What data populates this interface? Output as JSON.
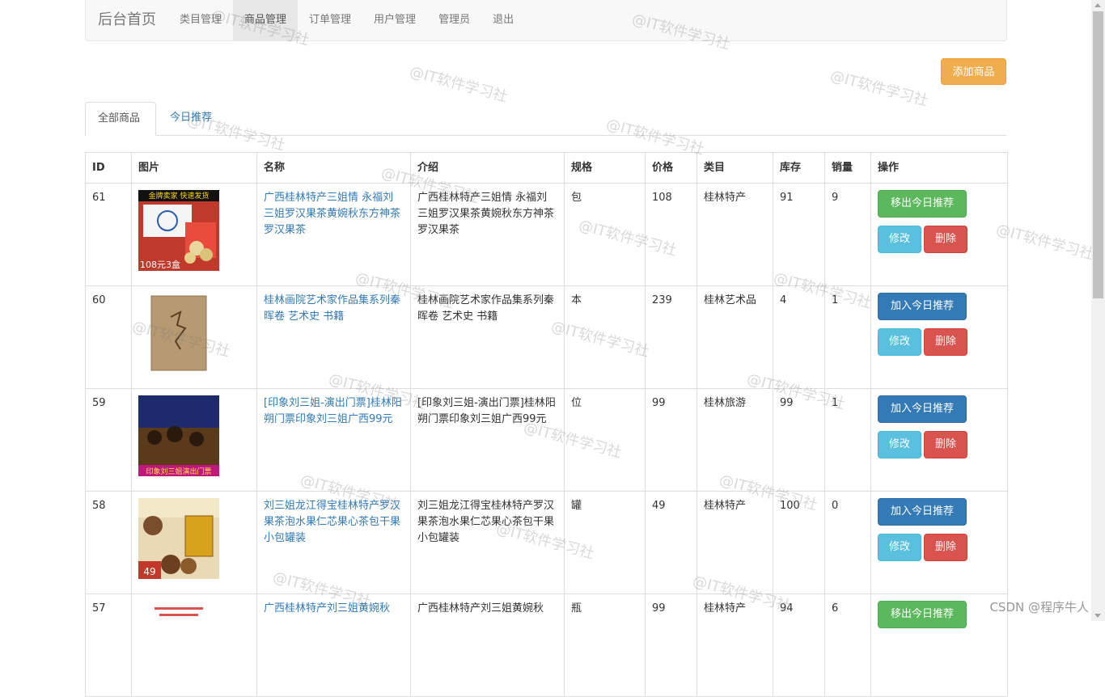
{
  "navbar": {
    "brand": "后台首页",
    "items": [
      "类目管理",
      "商品管理",
      "订单管理",
      "用户管理",
      "管理员",
      "退出"
    ],
    "active_index": 1
  },
  "add_button": "添加商品",
  "tabs": [
    "全部商品",
    "今日推荐"
  ],
  "table": {
    "headers": [
      "ID",
      "图片",
      "名称",
      "介绍",
      "规格",
      "价格",
      "类目",
      "库存",
      "销量",
      "操作"
    ],
    "rows": [
      {
        "id": "61",
        "name": "广西桂林特产三姐情 永福刘三姐罗汉果茶黄婉秋东方神茶罗汉果茶",
        "intro": "广西桂林特产三姐情 永福刘三姐罗汉果茶黄婉秋东方神茶罗汉果茶",
        "spec": "包",
        "price": "108",
        "category": "桂林特产",
        "stock": "91",
        "sales": "9",
        "rec_label": "移出今日推荐",
        "rec_type": "success",
        "img_caption": "金牌卖家 快速发货",
        "img_price": "108元3盒"
      },
      {
        "id": "60",
        "name": "桂林画院艺术家作品集系列秦晖卷 艺术史 书籍",
        "intro": "桂林画院艺术家作品集系列秦晖卷 艺术史 书籍",
        "spec": "本",
        "price": "239",
        "category": "桂林艺术品",
        "stock": "4",
        "sales": "1",
        "rec_label": "加入今日推荐",
        "rec_type": "primary",
        "img_caption": "",
        "img_price": ""
      },
      {
        "id": "59",
        "name": "[印象刘三姐-演出门票]桂林阳朔门票印象刘三姐广西99元",
        "intro": "[印象刘三姐-演出门票]桂林阳朔门票印象刘三姐广西99元",
        "spec": "位",
        "price": "99",
        "category": "桂林旅游",
        "stock": "99",
        "sales": "1",
        "rec_label": "加入今日推荐",
        "rec_type": "primary",
        "img_caption": "",
        "img_price": "印象刘三姐演出门票"
      },
      {
        "id": "58",
        "name": "刘三姐龙江得宝桂林特产罗汉果茶泡水果仁芯果心茶包干果小包罐装",
        "intro": "刘三姐龙江得宝桂林特产罗汉果茶泡水果仁芯果心茶包干果小包罐装",
        "spec": "罐",
        "price": "49",
        "category": "桂林特产",
        "stock": "100",
        "sales": "0",
        "rec_label": "加入今日推荐",
        "rec_type": "primary",
        "img_caption": "",
        "img_price": "49"
      },
      {
        "id": "57",
        "name": "广西桂林特产刘三姐黄婉秋",
        "intro": "广西桂林特产刘三姐黄婉秋",
        "spec": "瓶",
        "price": "99",
        "category": "桂林特产",
        "stock": "94",
        "sales": "6",
        "rec_label": "移出今日推荐",
        "rec_type": "success",
        "img_caption": "",
        "img_price": ""
      }
    ],
    "edit_label": "修改",
    "delete_label": "删除"
  },
  "watermark": "@IT软件学习社",
  "corner_text": "CSDN @程序牛人"
}
